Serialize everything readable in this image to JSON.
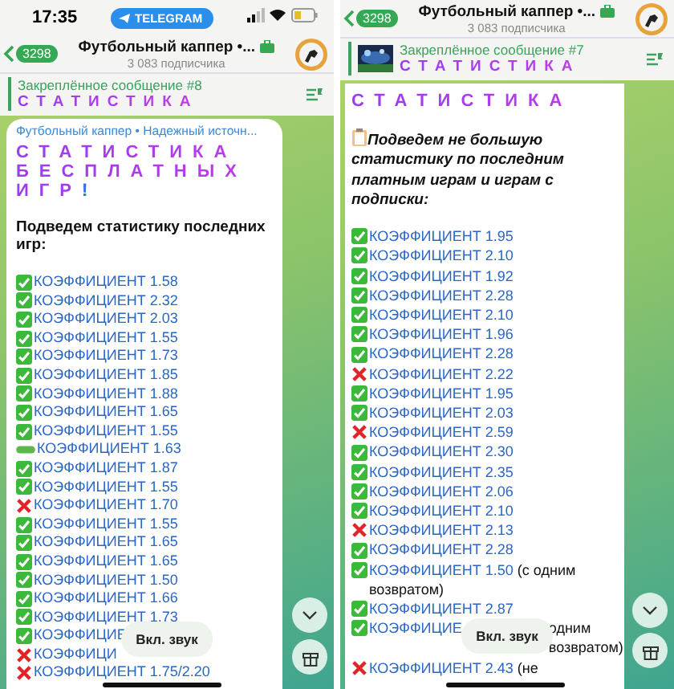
{
  "panels": [
    {
      "status_bar": {
        "time": "17:35",
        "app_pill": "TELEGRAM"
      },
      "header": {
        "unread": "3298",
        "title": "Футбольный каппер •...",
        "subtitle": "3 083 подписчика"
      },
      "pinned": {
        "label": "Закреплённое сообщение #8",
        "text": "СТАТИСТИКА",
        "has_thumbnail": false
      },
      "message": {
        "sender": "Футбольный каппер • Надежный источн...",
        "title": "СТАТИСТИКА БЕСПЛАТНЫХ ИГР",
        "title_mark": "!",
        "intro": "Подведем статистику последних игр:",
        "intro_icon": false,
        "results": [
          {
            "kind": "win",
            "text": "КОЭФФИЦИЕНТ 1.58"
          },
          {
            "kind": "win",
            "text": "КОЭФФИЦИЕНТ 2.32"
          },
          {
            "kind": "win",
            "text": "КОЭФФИЦИЕНТ 2.03"
          },
          {
            "kind": "win",
            "text": "КОЭФФИЦИЕНТ 1.55"
          },
          {
            "kind": "win",
            "text": "КОЭФФИЦИЕНТ 1.73"
          },
          {
            "kind": "win",
            "text": "КОЭФФИЦИЕНТ 1.85"
          },
          {
            "kind": "win",
            "text": "КОЭФФИЦИЕНТ 1.88"
          },
          {
            "kind": "win",
            "text": "КОЭФФИЦИЕНТ 1.65"
          },
          {
            "kind": "win",
            "text": "КОЭФФИЦИЕНТ 1.55"
          },
          {
            "kind": "push",
            "text": "КОЭФФИЦИЕНТ 1.63"
          },
          {
            "kind": "win",
            "text": "КОЭФФИЦИЕНТ 1.87"
          },
          {
            "kind": "win",
            "text": "КОЭФФИЦИЕНТ 1.55"
          },
          {
            "kind": "loss",
            "text": "КОЭФФИЦИЕНТ 1.70"
          },
          {
            "kind": "win",
            "text": "КОЭФФИЦИЕНТ 1.55"
          },
          {
            "kind": "win",
            "text": "КОЭФФИЦИЕНТ 1.65"
          },
          {
            "kind": "win",
            "text": "КОЭФФИЦИЕНТ 1.65"
          },
          {
            "kind": "win",
            "text": "КОЭФФИЦИЕНТ 1.50"
          },
          {
            "kind": "win",
            "text": "КОЭФФИЦИЕНТ 1.66"
          },
          {
            "kind": "win",
            "text": "КОЭФФИЦИЕНТ 1.73"
          },
          {
            "kind": "win",
            "text": "КОЭФФИЦИЕ"
          },
          {
            "kind": "loss",
            "text": "КОЭФФИЦИ"
          },
          {
            "kind": "loss",
            "text": "КОЭФФИЦИЕНТ 1.75/2.20"
          }
        ]
      },
      "mute_button": "Вкл. звук"
    },
    {
      "header": {
        "unread": "3298",
        "title": "Футбольный каппер •...",
        "subtitle": "3 083 подписчика"
      },
      "pinned": {
        "label": "Закреплённое сообщение #7",
        "text": "СТАТИСТИКА",
        "has_thumbnail": true
      },
      "message": {
        "title": "СТАТИСТИКА",
        "intro": "Подведем не большую статистику по последним платным играм и играм с подписки:",
        "intro_icon": true,
        "results": [
          {
            "kind": "win",
            "text": "КОЭФФИЦИЕНТ 1.95"
          },
          {
            "kind": "win",
            "text": "КОЭФФИЦИЕНТ 2.10"
          },
          {
            "kind": "win",
            "text": "КОЭФФИЦИЕНТ 1.92"
          },
          {
            "kind": "win",
            "text": "КОЭФФИЦИЕНТ 2.28"
          },
          {
            "kind": "win",
            "text": "КОЭФФИЦИЕНТ 2.10"
          },
          {
            "kind": "win",
            "text": "КОЭФФИЦИЕНТ 1.96"
          },
          {
            "kind": "win",
            "text": "КОЭФФИЦИЕНТ 2.28"
          },
          {
            "kind": "loss",
            "text": "КОЭФФИЦИЕНТ 2.22"
          },
          {
            "kind": "win",
            "text": "КОЭФФИЦИЕНТ 1.95"
          },
          {
            "kind": "win",
            "text": "КОЭФФИЦИЕНТ 2.03"
          },
          {
            "kind": "loss",
            "text": "КОЭФФИЦИЕНТ 2.59"
          },
          {
            "kind": "win",
            "text": "КОЭФФИЦИЕНТ 2.30"
          },
          {
            "kind": "win",
            "text": "КОЭФФИЦИЕНТ 2.35"
          },
          {
            "kind": "win",
            "text": "КОЭФФИЦИЕНТ 2.06"
          },
          {
            "kind": "win",
            "text": "КОЭФФИЦИЕНТ 2.10"
          },
          {
            "kind": "loss",
            "text": "КОЭФФИЦИЕНТ 2.13"
          },
          {
            "kind": "win",
            "text": "КОЭФФИЦИЕНТ 2.28"
          },
          {
            "kind": "win",
            "text": "КОЭФФИЦИЕНТ 1.50",
            "note": "(с одним возвратом)"
          },
          {
            "kind": "win",
            "text": "КОЭФФИЦИЕНТ 2.87"
          },
          {
            "kind": "win",
            "text": "КОЭФФИЦИЕ",
            "note": "одним возвратом)",
            "covered": true
          },
          {
            "kind": "loss",
            "text": "КОЭФФИЦИЕНТ 2.43",
            "note": "(не"
          }
        ]
      },
      "mute_button": "Вкл. звук"
    }
  ]
}
